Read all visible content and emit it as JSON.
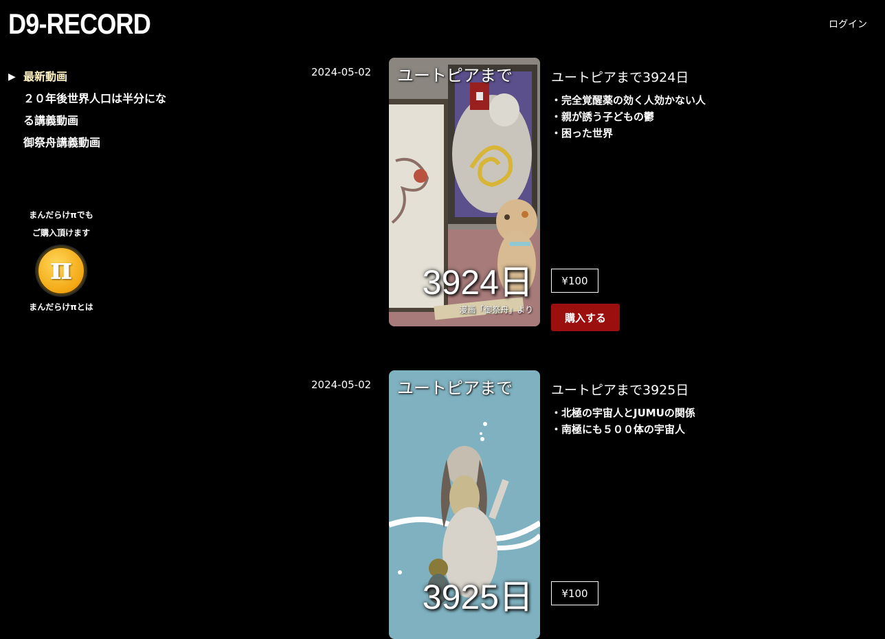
{
  "header": {
    "logo": "D9-RECORD",
    "login_label": "ログイン"
  },
  "sidebar": {
    "active_marker": "▶",
    "items": [
      {
        "label": "最新動画",
        "active": true
      },
      {
        "label": "２０年後世界人口は半分になる講義動画",
        "active": false
      },
      {
        "label": "御祭舟講義動画",
        "active": false
      }
    ]
  },
  "promo": {
    "line1": "まんだらけπでも",
    "line2": "ご購入頂けます",
    "coin_symbol": "π",
    "coin_icon": "pi-coin-icon",
    "link_label": "まんだらけπとは",
    "coin_color": "#f3a712"
  },
  "posts": [
    {
      "date": "2024-05-02",
      "title": "ユートピアまで3924日",
      "thumb_caption": "ユートピアまで",
      "thumb_days": "3924日",
      "thumb_credit": "漫画「御祭舟」より",
      "bullets": [
        "・完全覚醒薬の効く人効かない人",
        "・親が誘う子どもの鬱",
        "・困った世界"
      ],
      "price": "¥100",
      "buy_label": "購入する"
    },
    {
      "date": "2024-05-02",
      "title": "ユートピアまで3925日",
      "thumb_caption": "ユートピアまで",
      "thumb_days": "3925日",
      "bullets": [
        "・北極の宇宙人とJUMUの関係",
        "・南極にも５００体の宇宙人"
      ],
      "price": "¥100"
    }
  ],
  "colors": {
    "background": "#000000",
    "buy_button": "#9c0f0f",
    "active_nav": "#fff3c4"
  }
}
